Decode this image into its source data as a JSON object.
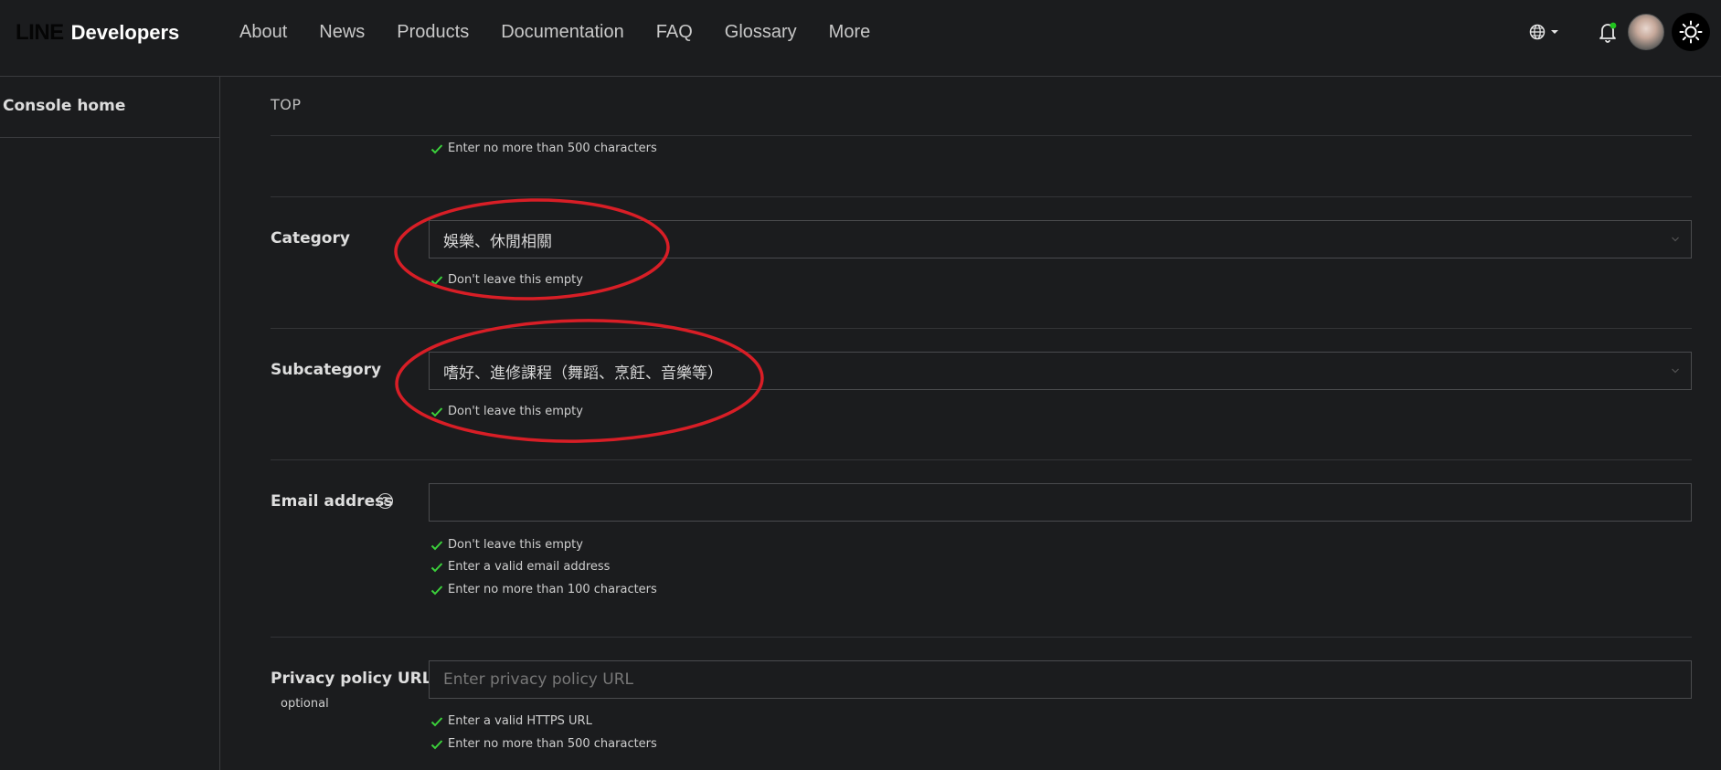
{
  "header": {
    "logo_line": "LINE",
    "logo_developers": "Developers",
    "nav": [
      "About",
      "News",
      "Products",
      "Documentation",
      "FAQ",
      "Glossary",
      "More"
    ]
  },
  "sidebar": {
    "console_home": "Console home"
  },
  "breadcrumb": "TOP",
  "form": {
    "prev_field_msg": "Enter no more than 500 characters",
    "category": {
      "label": "Category",
      "value": "娛樂、休閒相關",
      "msgs": [
        "Don't leave this empty"
      ]
    },
    "subcategory": {
      "label": "Subcategory",
      "value": "嗜好、進修課程（舞蹈、烹飪、音樂等）",
      "msgs": [
        "Don't leave this empty"
      ]
    },
    "email": {
      "label": "Email address",
      "value": "",
      "msgs": [
        "Don't leave this empty",
        "Enter a valid email address",
        "Enter no more than 100 characters"
      ]
    },
    "privacy": {
      "label": "Privacy policy URL",
      "sublabel": "optional",
      "placeholder": "Enter privacy policy URL",
      "msgs": [
        "Enter a valid HTTPS URL",
        "Enter no more than 500 characters"
      ]
    }
  },
  "colors": {
    "background": "#1b1c1e",
    "check_green": "#3bd13b",
    "annotation_red": "#d81e26",
    "notification_dot": "#21c21e"
  }
}
